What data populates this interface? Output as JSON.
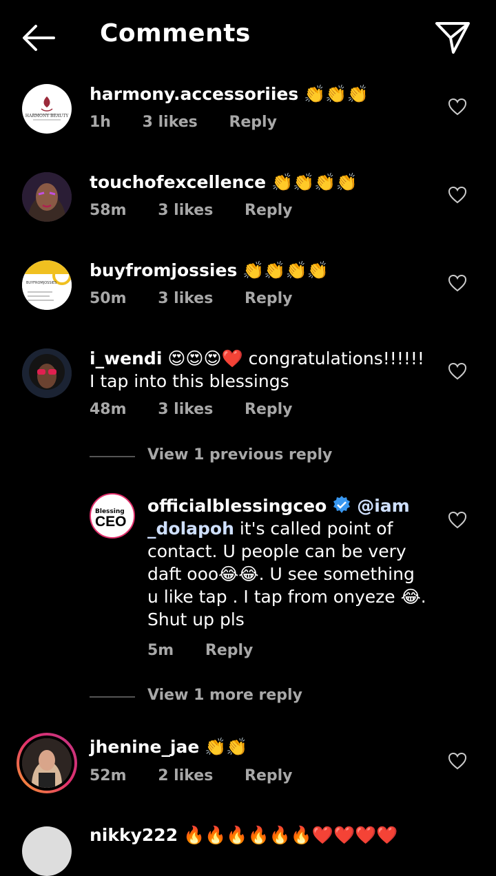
{
  "header": {
    "title": "Comments",
    "back_icon": "back-arrow-icon",
    "share_icon": "send-icon"
  },
  "comments": [
    {
      "username": "harmony.accessoriies",
      "text": "👏👏👏",
      "time": "1h",
      "likes": "3 likes",
      "reply": "Reply",
      "avatar_label": "HARMONY BEAUTY"
    },
    {
      "username": "touchofexcellence",
      "text": "👏👏👏👏",
      "time": "58m",
      "likes": "3 likes",
      "reply": "Reply"
    },
    {
      "username": "buyfromjossies",
      "text": "👏👏👏👏",
      "time": "50m",
      "likes": "3 likes",
      "reply": "Reply",
      "avatar_label": "BUYFROMJOSSIES"
    },
    {
      "username": "i_wendi",
      "text": "😍😍😍❤️ congratulations!!!!!! I tap into this blessings",
      "time": "48m",
      "likes": "3 likes",
      "reply": "Reply"
    },
    {
      "username": "jhenine_jae",
      "text": "👏👏",
      "time": "52m",
      "likes": "2 likes",
      "reply": "Reply"
    },
    {
      "username": "nikky222",
      "text": "🔥🔥🔥🔥🔥🔥❤️❤️❤️❤️"
    }
  ],
  "view_previous": "View 1 previous reply",
  "reply": {
    "username": "officialblessingceo",
    "mention": "@iam _dolapoh",
    "text": " it's called point of contact. U people can be very daft ooo😂😂. U see something u like tap . I tap from onyeze 😂. Shut up pls",
    "time": "5m",
    "reply": "Reply",
    "avatar_top": "Blessing",
    "avatar_main": "CEO"
  },
  "view_more": "View 1 more reply",
  "colors": {
    "background": "#000000",
    "text": "#ffffff",
    "meta": "#a8a8a8",
    "verified": "#3897f0",
    "story_ring": "#e1306c"
  }
}
